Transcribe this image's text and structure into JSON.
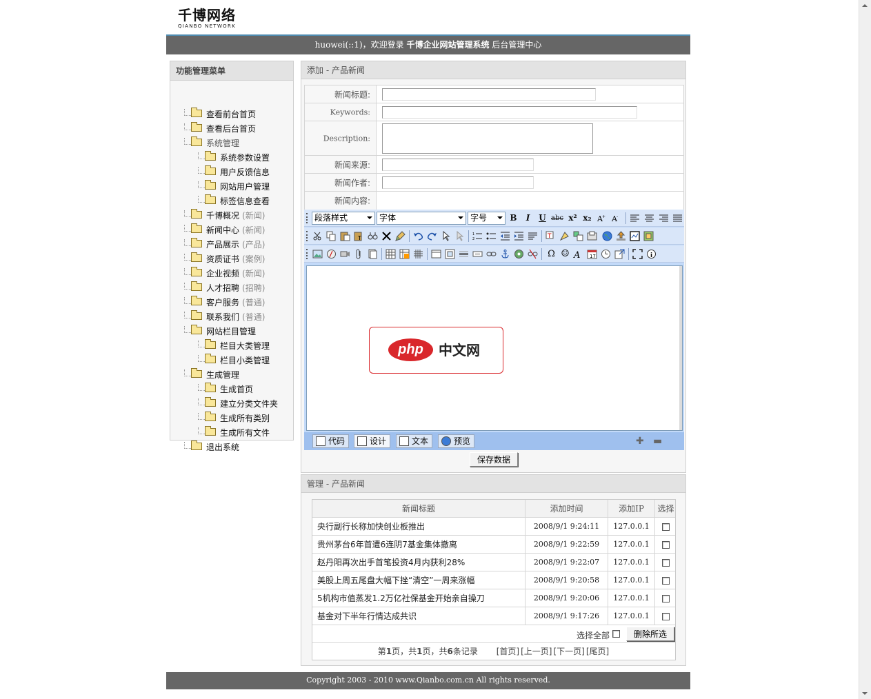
{
  "logo": {
    "cn": "千博网络",
    "en": "QIANBO NETWORK"
  },
  "header": {
    "user": "huowei(::1)",
    "welcome": "，欢迎登录",
    "system_name": "千博企业网站管理系统",
    "center": "后台管理中心"
  },
  "sidebar": {
    "title": "功能管理菜单",
    "items": [
      {
        "label": "查看前台首页",
        "tag": ""
      },
      {
        "label": "查看后台首页",
        "tag": ""
      },
      {
        "label": "系统管理",
        "tag": ""
      },
      {
        "label": "系统参数设置",
        "tag": ""
      },
      {
        "label": "用户反馈信息",
        "tag": ""
      },
      {
        "label": "网站用户管理",
        "tag": ""
      },
      {
        "label": "标签信息查看",
        "tag": ""
      },
      {
        "label": "千博概况",
        "tag": "(新闻)"
      },
      {
        "label": "新闻中心",
        "tag": "(新闻)"
      },
      {
        "label": "产品展示",
        "tag": "(产品)"
      },
      {
        "label": "资质证书",
        "tag": "(案例)"
      },
      {
        "label": "企业视频",
        "tag": "(新闻)"
      },
      {
        "label": "人才招聘",
        "tag": "(招聘)"
      },
      {
        "label": "客户服务",
        "tag": "(普通)"
      },
      {
        "label": "联系我们",
        "tag": "(普通)"
      },
      {
        "label": "网站栏目管理",
        "tag": ""
      },
      {
        "label": "栏目大类管理",
        "tag": ""
      },
      {
        "label": "栏目小类管理",
        "tag": ""
      },
      {
        "label": "生成管理",
        "tag": ""
      },
      {
        "label": "生成首页",
        "tag": ""
      },
      {
        "label": "建立分类文件夹",
        "tag": ""
      },
      {
        "label": "生成所有类别",
        "tag": ""
      },
      {
        "label": "生成所有文件",
        "tag": ""
      },
      {
        "label": "退出系统",
        "tag": ""
      }
    ]
  },
  "add_panel": {
    "title": "添加 - 产品新闻",
    "fields": {
      "title_label": "新闻标题:",
      "title_value": "",
      "keywords_label": "Keywords:",
      "keywords_value": "",
      "description_label": "Description:",
      "description_value": "",
      "source_label": "新闻来源:",
      "source_value": "",
      "author_label": "新闻作者:",
      "author_value": "",
      "content_label": "新闻内容:"
    },
    "editor": {
      "paragraph_style": "段落样式",
      "font": "字体",
      "font_size": "字号",
      "bold": "B",
      "italic": "I",
      "underline": "U",
      "strike": "abc",
      "superscript": "x²",
      "subscript": "x₂",
      "tabs": {
        "code": "代码",
        "design": "设计",
        "text": "文本",
        "preview": "预览"
      },
      "watermark": {
        "php": "php",
        "cn": "中文网"
      }
    },
    "save_label": "保存数据"
  },
  "manage_panel": {
    "title": "管理 - 产品新闻",
    "headers": [
      "新闻标题",
      "添加时间",
      "添加IP",
      "选择"
    ],
    "rows": [
      {
        "title": "央行副行长称加快创业板推出",
        "time": "2008/9/1 9:24:11",
        "ip": "127.0.0.1"
      },
      {
        "title": "贵州茅台6年首遭6连阴7基金集体撤离",
        "time": "2008/9/1 9:22:59",
        "ip": "127.0.0.1"
      },
      {
        "title": "赵丹阳再次出手首笔投资4月内获利28%",
        "time": "2008/9/1 9:22:07",
        "ip": "127.0.0.1"
      },
      {
        "title": "美股上周五尾盘大幅下挫“清空”一周来涨幅",
        "time": "2008/9/1 9:20:58",
        "ip": "127.0.0.1"
      },
      {
        "title": "5机构市值蒸发1.2万亿社保基金开始亲自操刀",
        "time": "2008/9/1 9:20:06",
        "ip": "127.0.0.1"
      },
      {
        "title": "基金对下半年行情达成共识",
        "time": "2008/9/1 9:17:26",
        "ip": "127.0.0.1"
      }
    ],
    "select_all": "选择全部",
    "delete_label": "删除所选",
    "pager": {
      "p1": "第",
      "current": "1",
      "p2": "页，共",
      "total_pages": "1",
      "p3": "页，共",
      "total_records": "6",
      "p4": "条记录",
      "first": "[首页]",
      "prev": "[上一页]",
      "next": "[下一页]",
      "last": "[尾页]"
    }
  },
  "footer": {
    "text": "Copyright 2003 - 2010 www.Qianbo.com.cn All rights reserved."
  },
  "colors": {
    "header_bg": "#666666",
    "accent_line": "#4f8cb0",
    "editor_bg": "#c3daf9",
    "watermark_red": "#d9272b"
  }
}
